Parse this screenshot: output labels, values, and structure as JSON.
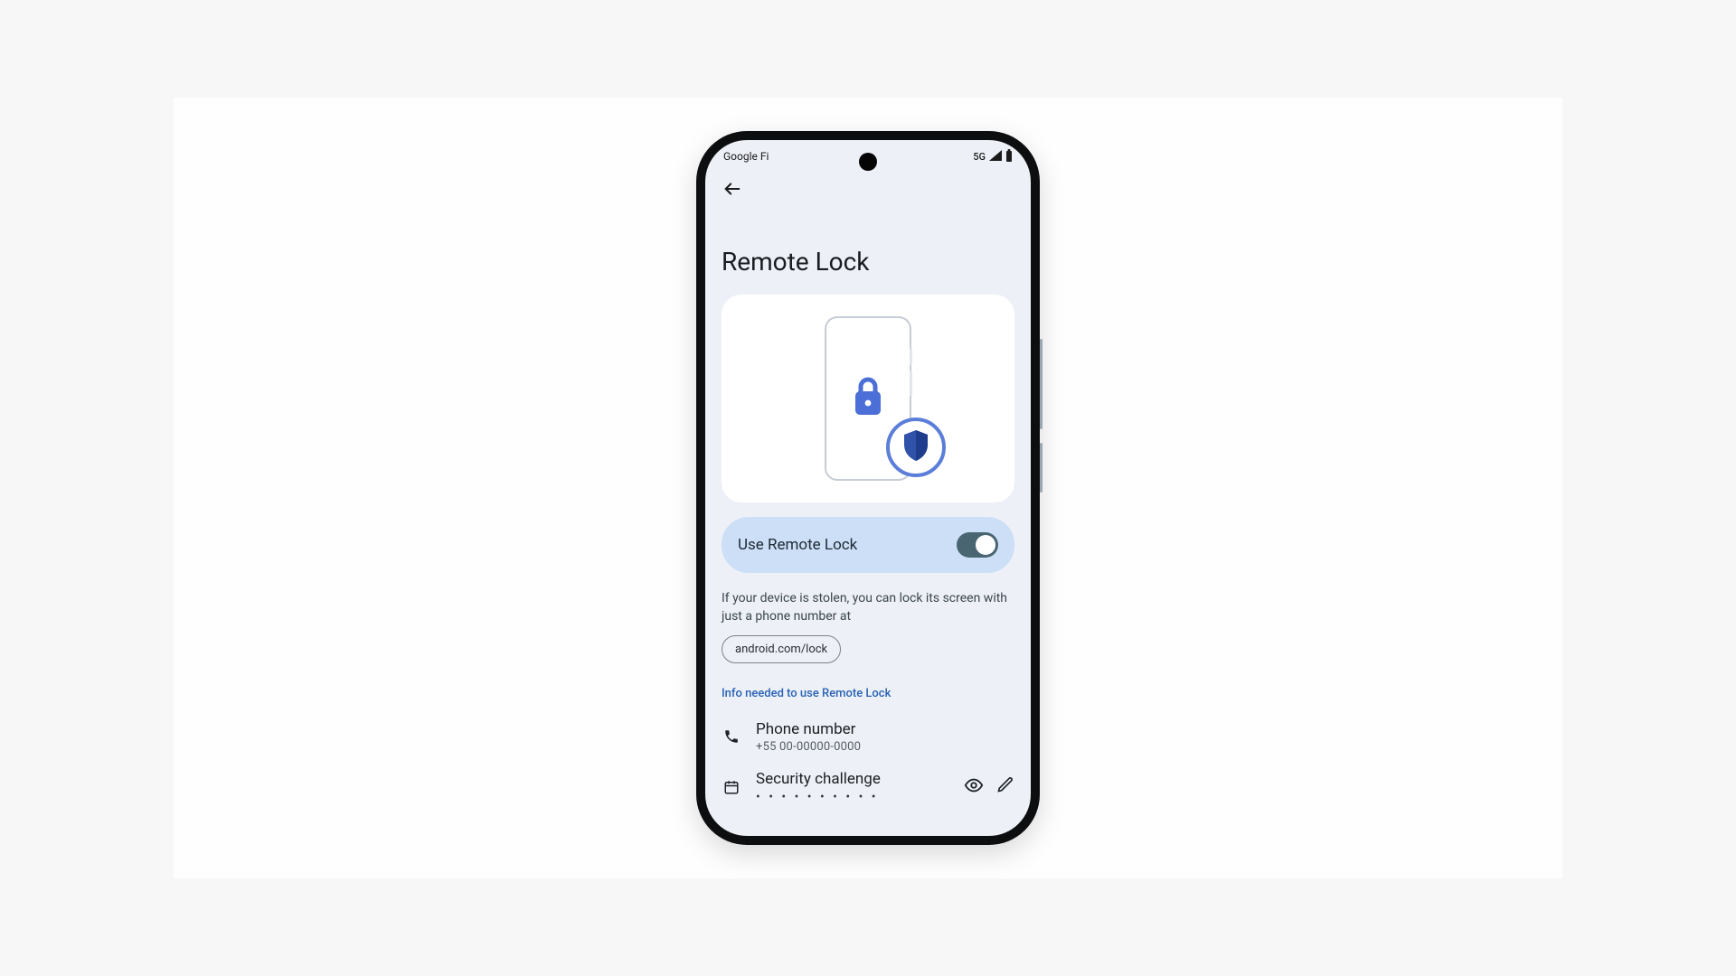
{
  "statusbar": {
    "carrier": "Google Fi",
    "network": "5G"
  },
  "page": {
    "title": "Remote Lock"
  },
  "toggle": {
    "label": "Use Remote Lock",
    "enabled": true
  },
  "description": {
    "text": "If your device is stolen, you can lock its screen with just a phone number at",
    "link": "android.com/lock"
  },
  "section": {
    "header": "Info needed to use Remote Lock"
  },
  "items": [
    {
      "icon": "phone",
      "title": "Phone number",
      "subtitle": "+55 00-00000-0000"
    },
    {
      "icon": "calendar",
      "title": "Security challenge",
      "subtitle": "• • • • • • • • • •"
    }
  ]
}
